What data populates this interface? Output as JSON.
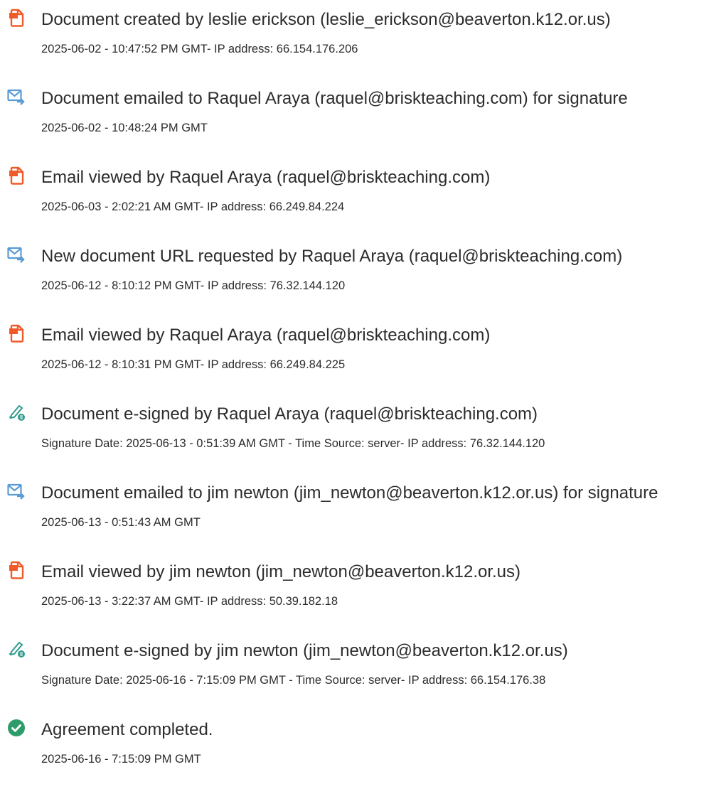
{
  "colors": {
    "doc_icon": "#f05a28",
    "email_icon": "#5b9bd5",
    "sign_icon": "#2f9c8c",
    "complete_icon": "#2e9c6a",
    "text": "#2c2c2c"
  },
  "events": [
    {
      "icon": "document-icon",
      "title": "Document created by leslie erickson (leslie_erickson@beaverton.k12.or.us)",
      "detail": "2025-06-02 - 10:47:52 PM GMT- IP address: 66.154.176.206"
    },
    {
      "icon": "email-icon",
      "title": "Document emailed to Raquel Araya (raquel@briskteaching.com) for signature",
      "detail": "2025-06-02 - 10:48:24 PM GMT"
    },
    {
      "icon": "document-icon",
      "title": "Email viewed by Raquel Araya (raquel@briskteaching.com)",
      "detail": "2025-06-03 - 2:02:21 AM GMT- IP address: 66.249.84.224"
    },
    {
      "icon": "email-icon",
      "title": "New document URL requested by Raquel Araya (raquel@briskteaching.com)",
      "detail": "2025-06-12 - 8:10:12 PM GMT- IP address: 76.32.144.120"
    },
    {
      "icon": "document-icon",
      "title": "Email viewed by Raquel Araya (raquel@briskteaching.com)",
      "detail": "2025-06-12 - 8:10:31 PM GMT- IP address: 66.249.84.225"
    },
    {
      "icon": "pen-sign-icon",
      "title": "Document e-signed by Raquel Araya (raquel@briskteaching.com)",
      "detail": "Signature Date: 2025-06-13 - 0:51:39 AM GMT - Time Source: server- IP address: 76.32.144.120"
    },
    {
      "icon": "email-icon",
      "title": "Document emailed to jim newton (jim_newton@beaverton.k12.or.us) for signature",
      "detail": "2025-06-13 - 0:51:43 AM GMT"
    },
    {
      "icon": "document-icon",
      "title": "Email viewed by jim newton (jim_newton@beaverton.k12.or.us)",
      "detail": "2025-06-13 - 3:22:37 AM GMT- IP address: 50.39.182.18"
    },
    {
      "icon": "pen-sign-icon",
      "title": "Document e-signed by jim newton (jim_newton@beaverton.k12.or.us)",
      "detail": "Signature Date: 2025-06-16 - 7:15:09 PM GMT - Time Source: server- IP address: 66.154.176.38"
    },
    {
      "icon": "check-circle-icon",
      "title": "Agreement completed.",
      "detail": "2025-06-16 - 7:15:09 PM GMT"
    }
  ]
}
